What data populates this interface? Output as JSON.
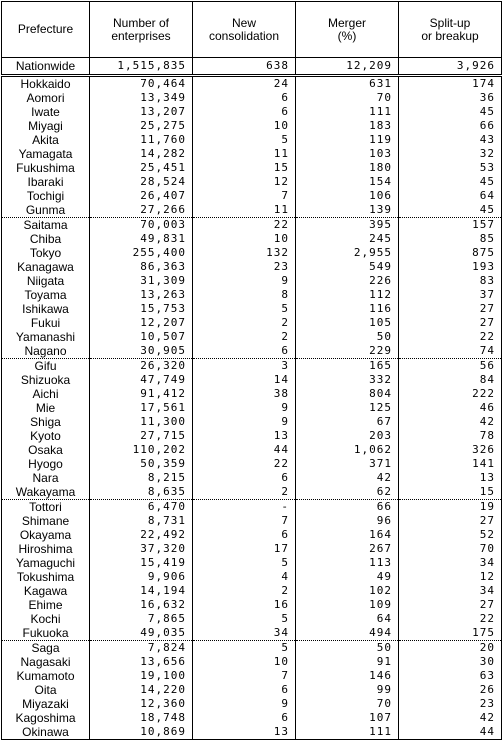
{
  "headers": [
    "Prefecture",
    "Number of\nenterprises",
    "New\nconsolidation",
    "Merger\n(%)",
    "Split-up\nor breakup"
  ],
  "nationwide": {
    "name": "Nationwide",
    "enterprises": "1,515,835",
    "new_consolidation": "638",
    "merger": "12,209",
    "split_up": "3,926"
  },
  "groups": [
    [
      [
        "Hokkaido",
        "70,464",
        "24",
        "631",
        "174"
      ],
      [
        "Aomori",
        "13,349",
        "6",
        "70",
        "36"
      ],
      [
        "Iwate",
        "13,207",
        "6",
        "111",
        "45"
      ],
      [
        "Miyagi",
        "25,275",
        "10",
        "183",
        "66"
      ],
      [
        "Akita",
        "11,760",
        "5",
        "119",
        "43"
      ],
      [
        "Yamagata",
        "14,282",
        "11",
        "103",
        "32"
      ],
      [
        "Fukushima",
        "25,451",
        "15",
        "180",
        "53"
      ],
      [
        "Ibaraki",
        "28,524",
        "12",
        "154",
        "45"
      ],
      [
        "Tochigi",
        "26,407",
        "7",
        "106",
        "64"
      ],
      [
        "Gunma",
        "27,266",
        "11",
        "139",
        "45"
      ]
    ],
    [
      [
        "Saitama",
        "70,003",
        "22",
        "395",
        "157"
      ],
      [
        "Chiba",
        "49,831",
        "10",
        "245",
        "85"
      ],
      [
        "Tokyo",
        "255,400",
        "132",
        "2,955",
        "875"
      ],
      [
        "Kanagawa",
        "86,363",
        "23",
        "549",
        "193"
      ],
      [
        "Niigata",
        "31,309",
        "9",
        "226",
        "83"
      ],
      [
        "Toyama",
        "13,263",
        "8",
        "112",
        "37"
      ],
      [
        "Ishikawa",
        "15,753",
        "5",
        "116",
        "27"
      ],
      [
        "Fukui",
        "12,207",
        "2",
        "105",
        "27"
      ],
      [
        "Yamanashi",
        "10,507",
        "2",
        "50",
        "22"
      ],
      [
        "Nagano",
        "30,905",
        "6",
        "229",
        "74"
      ]
    ],
    [
      [
        "Gifu",
        "26,320",
        "3",
        "165",
        "56"
      ],
      [
        "Shizuoka",
        "47,749",
        "14",
        "332",
        "84"
      ],
      [
        "Aichi",
        "91,412",
        "38",
        "804",
        "222"
      ],
      [
        "Mie",
        "17,561",
        "9",
        "125",
        "46"
      ],
      [
        "Shiga",
        "11,300",
        "9",
        "67",
        "42"
      ],
      [
        "Kyoto",
        "27,715",
        "13",
        "203",
        "78"
      ],
      [
        "Osaka",
        "110,202",
        "44",
        "1,062",
        "326"
      ],
      [
        "Hyogo",
        "50,359",
        "22",
        "371",
        "141"
      ],
      [
        "Nara",
        "8,215",
        "6",
        "42",
        "13"
      ],
      [
        "Wakayama",
        "8,635",
        "2",
        "62",
        "15"
      ]
    ],
    [
      [
        "Tottori",
        "6,470",
        "-",
        "66",
        "19"
      ],
      [
        "Shimane",
        "8,731",
        "7",
        "96",
        "27"
      ],
      [
        "Okayama",
        "22,492",
        "6",
        "164",
        "52"
      ],
      [
        "Hiroshima",
        "37,320",
        "17",
        "267",
        "70"
      ],
      [
        "Yamaguchi",
        "15,419",
        "5",
        "113",
        "34"
      ],
      [
        "Tokushima",
        "9,906",
        "4",
        "49",
        "12"
      ],
      [
        "Kagawa",
        "14,194",
        "2",
        "102",
        "34"
      ],
      [
        "Ehime",
        "16,632",
        "16",
        "109",
        "27"
      ],
      [
        "Kochi",
        "7,865",
        "5",
        "64",
        "22"
      ],
      [
        "Fukuoka",
        "49,035",
        "34",
        "494",
        "175"
      ]
    ],
    [
      [
        "Saga",
        "7,824",
        "5",
        "50",
        "20"
      ],
      [
        "Nagasaki",
        "13,656",
        "10",
        "91",
        "30"
      ],
      [
        "Kumamoto",
        "19,100",
        "7",
        "146",
        "63"
      ],
      [
        "Oita",
        "14,220",
        "6",
        "99",
        "26"
      ],
      [
        "Miyazaki",
        "12,360",
        "9",
        "70",
        "23"
      ],
      [
        "Kagoshima",
        "18,748",
        "6",
        "107",
        "42"
      ],
      [
        "Okinawa",
        "10,869",
        "13",
        "111",
        "44"
      ]
    ]
  ]
}
